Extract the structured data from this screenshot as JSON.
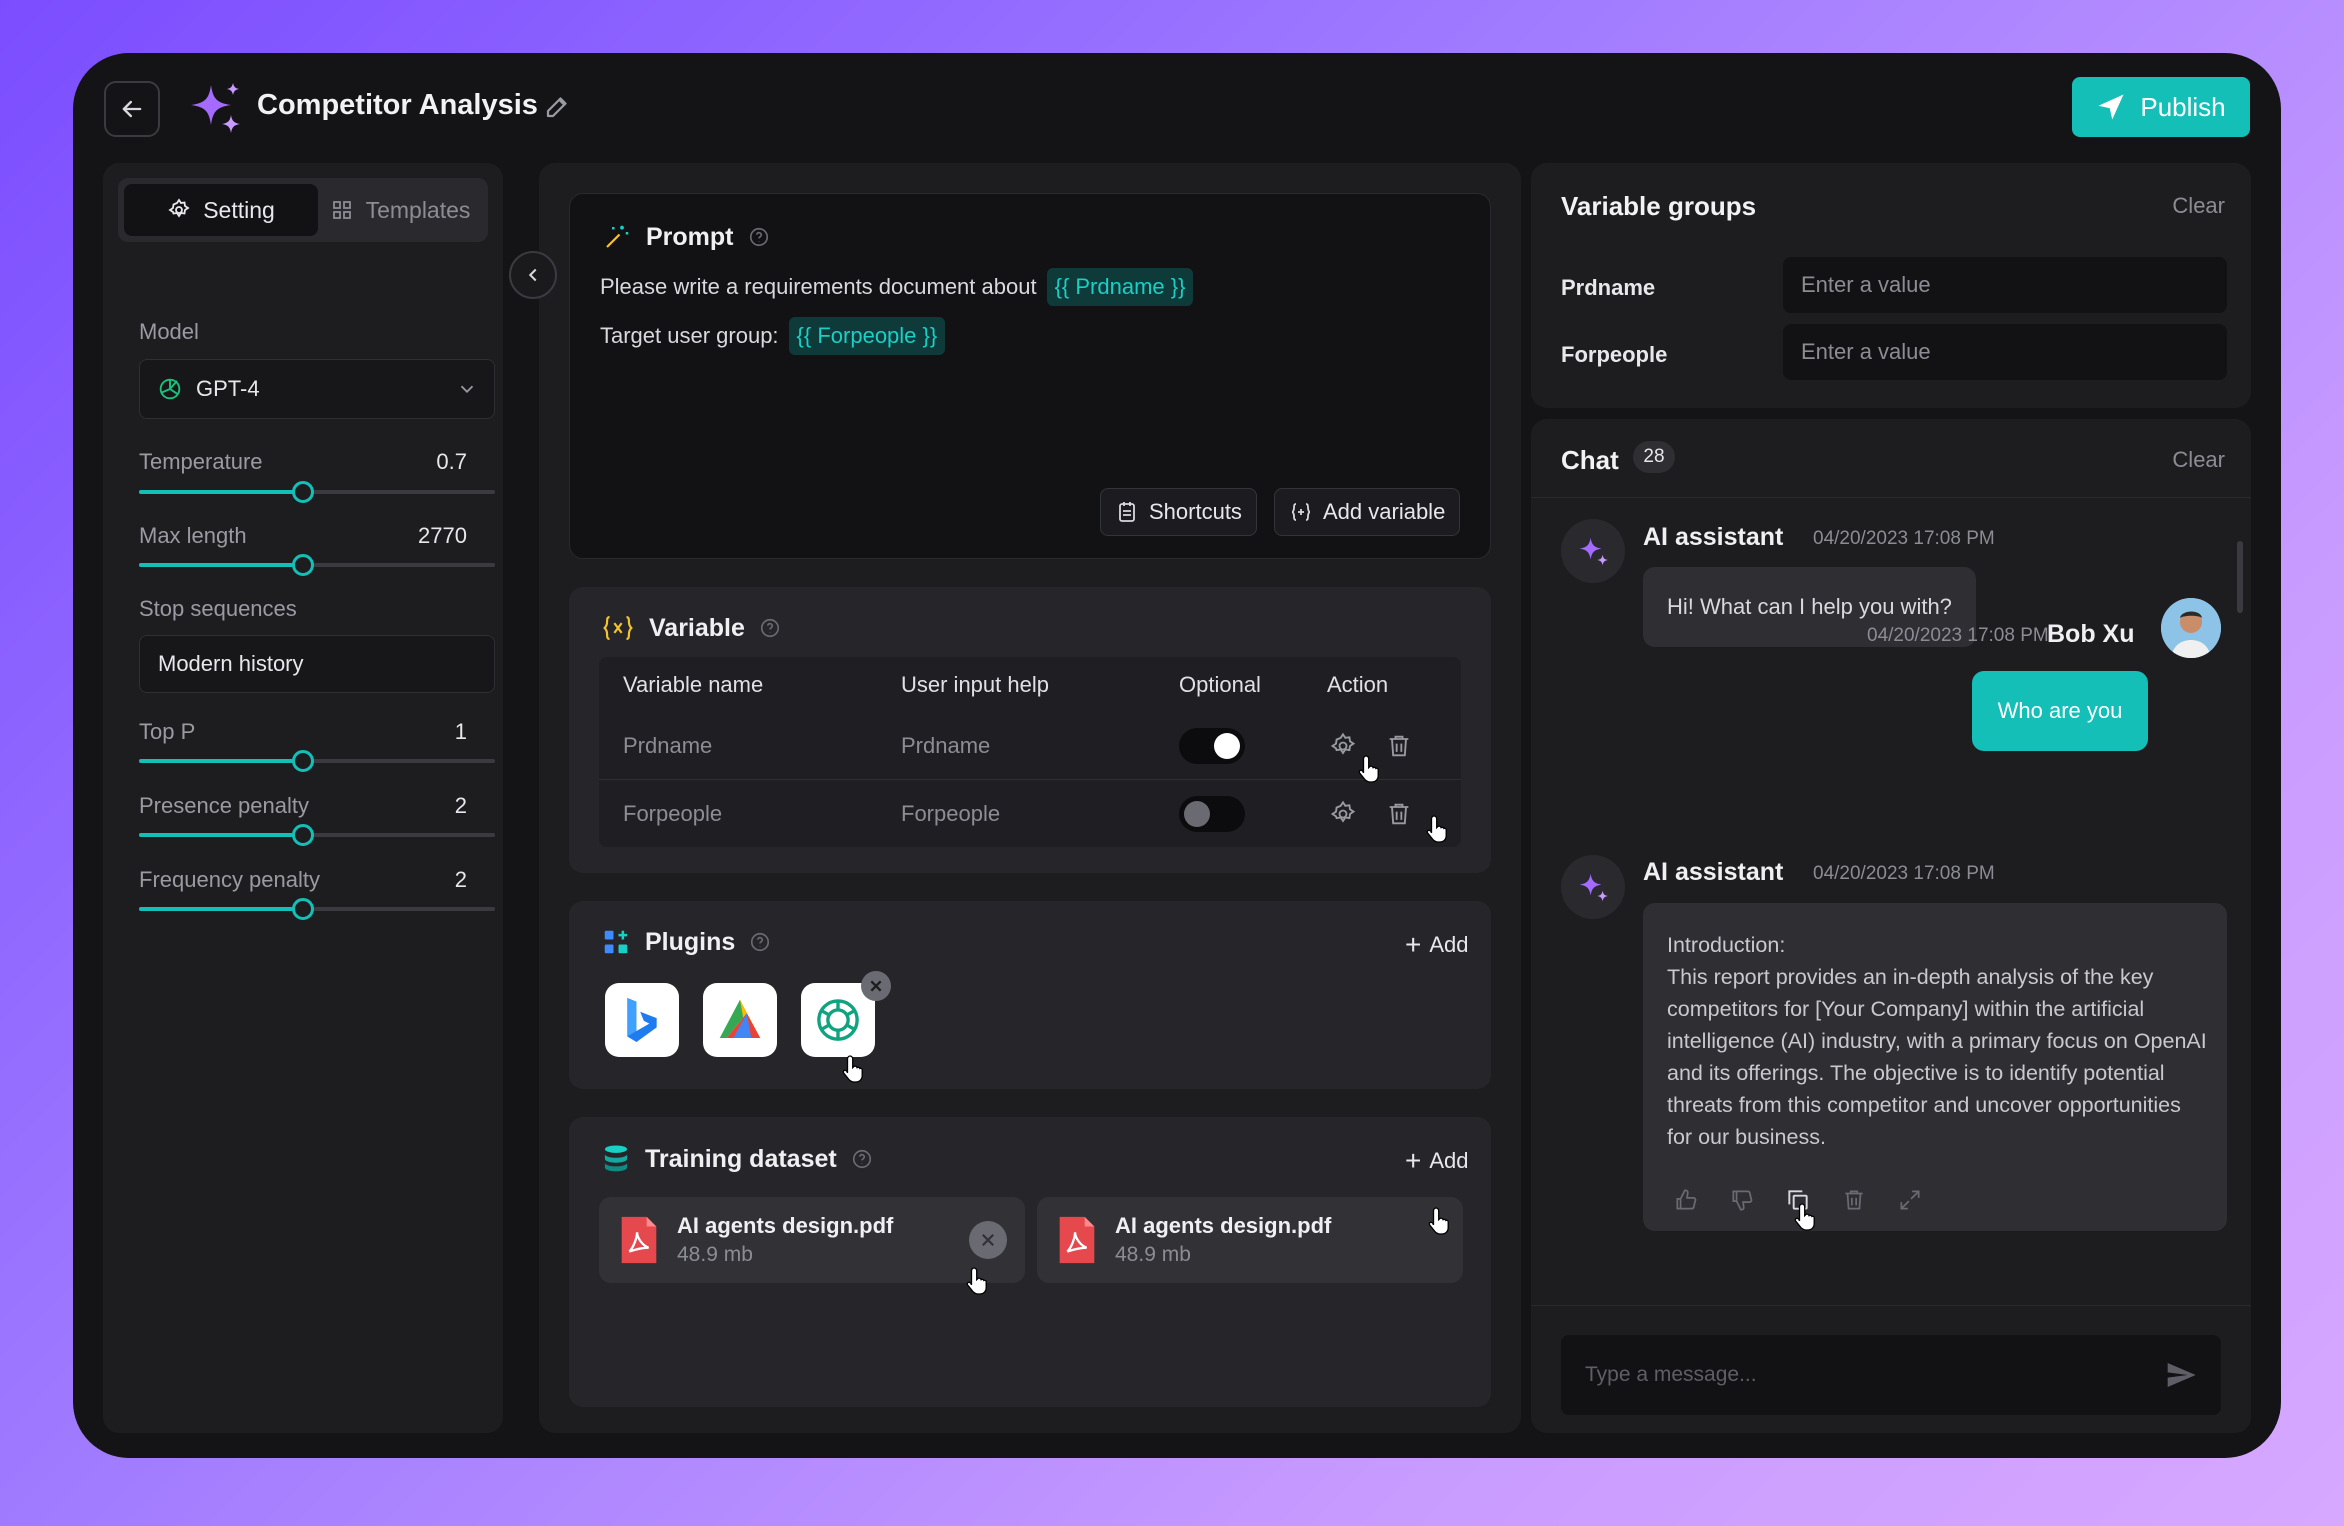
{
  "header": {
    "title": "Competitor Analysis",
    "publish_label": "Publish"
  },
  "colors": {
    "accent": "#14bfb8",
    "brand_purple": "#a56bff",
    "panel": "#1d1d20"
  },
  "left": {
    "tabs": [
      {
        "label": "Setting",
        "active": true
      },
      {
        "label": "Templates",
        "active": false
      }
    ],
    "model_label": "Model",
    "model_value": "GPT-4",
    "sliders": [
      {
        "label": "Temperature",
        "value": "0.7",
        "fraction": 0.46
      },
      {
        "label": "Max length",
        "value": "2770",
        "fraction": 0.46
      }
    ],
    "stop_label": "Stop sequences",
    "stop_value": "Modern history",
    "sliders2": [
      {
        "label": "Top P",
        "value": "1",
        "fraction": 0.46
      },
      {
        "label": "Presence penalty",
        "value": "2",
        "fraction": 0.46
      },
      {
        "label": "Frequency penalty",
        "value": "2",
        "fraction": 0.46
      }
    ]
  },
  "prompt": {
    "title": "Prompt",
    "line1_text": "Please write a requirements document about",
    "line1_var": "{{ Prdname }}",
    "line2_text": "Target user group:",
    "line2_var": "{{ Forpeople }}",
    "shortcuts_label": "Shortcuts",
    "add_variable_label": "Add variable"
  },
  "variable": {
    "title": "Variable",
    "columns": [
      "Variable name",
      "User input help",
      "Optional",
      "Action"
    ],
    "rows": [
      {
        "name": "Prdname",
        "help": "Prdname",
        "optional": true
      },
      {
        "name": "Forpeople",
        "help": "Forpeople",
        "optional": false
      }
    ]
  },
  "plugins": {
    "title": "Plugins",
    "add_label": "Add",
    "items": [
      "bing-icon",
      "maps-icon",
      "openai-icon"
    ]
  },
  "dataset": {
    "title": "Training dataset",
    "add_label": "Add",
    "files": [
      {
        "name": "AI agents design.pdf",
        "size": "48.9 mb"
      },
      {
        "name": "AI agents design.pdf",
        "size": "48.9 mb"
      }
    ]
  },
  "variable_groups": {
    "title": "Variable groups",
    "clear_label": "Clear",
    "fields": [
      {
        "label": "Prdname",
        "placeholder": "Enter a value"
      },
      {
        "label": "Forpeople",
        "placeholder": "Enter a value"
      }
    ]
  },
  "chat": {
    "title": "Chat",
    "count": "28",
    "clear_label": "Clear",
    "messages": [
      {
        "sender": "AI assistant",
        "time": "04/20/2023 17:08 PM",
        "text": "Hi! What can I help you with?"
      },
      {
        "sender": "Bob Xu",
        "time": "04/20/2023 17:08 PM",
        "text": "Who are you"
      },
      {
        "sender": "AI assistant",
        "time": "04/20/2023 17:08 PM",
        "text": "Introduction:\nThis report provides an in-depth analysis of the key competitors for [Your Company] within the artificial intelligence (AI) industry, with a primary focus on OpenAI and its offerings. The objective is to identify potential threats from this competitor and uncover opportunities for our business."
      }
    ],
    "composer_placeholder": "Type a message..."
  }
}
